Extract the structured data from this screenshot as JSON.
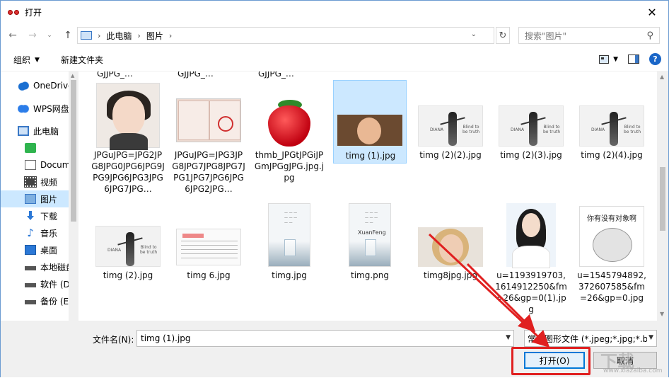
{
  "window": {
    "title": "打开",
    "close_glyph": "✕"
  },
  "nav": {
    "back": "←",
    "forward": "→",
    "up": "↑",
    "dropdown": "⌄",
    "breadcrumbs": [
      "此电脑",
      "图片"
    ],
    "sep": "›",
    "refresh": "↻",
    "search_placeholder": "搜索\"图片\""
  },
  "toolbar": {
    "organize": "组织",
    "new_folder": "新建文件夹",
    "help": "?"
  },
  "sidebar": {
    "items": [
      {
        "label": "OneDrive",
        "icon": "cloud-icon"
      },
      {
        "label": "WPS网盘",
        "icon": "wps-cloud-icon"
      },
      {
        "label": "此电脑",
        "icon": "computer-icon"
      },
      {
        "label": "",
        "icon": "green-app-icon"
      },
      {
        "label": "Documents",
        "icon": "document-icon"
      },
      {
        "label": "视频",
        "icon": "video-icon"
      },
      {
        "label": "图片",
        "icon": "pictures-icon"
      },
      {
        "label": "下载",
        "icon": "download-icon"
      },
      {
        "label": "音乐",
        "icon": "music-icon"
      },
      {
        "label": "桌面",
        "icon": "desktop-icon"
      },
      {
        "label": "本地磁盘",
        "icon": "drive-icon"
      },
      {
        "label": "软件 (D",
        "icon": "drive-icon"
      },
      {
        "label": "备份 (E",
        "icon": "drive-icon"
      }
    ]
  },
  "files": {
    "cutoff_row": [
      "GJJPG_…",
      "GJJPG_…",
      "GJJPG_…"
    ],
    "row1": [
      {
        "name": "JPGuJPG=JPG2JPG8JPG0JPG6JPG9JPG9JPG6JPG3JPG6JPG7JPG…",
        "thumb": "girl"
      },
      {
        "name": "JPGuJPG=JPG3JPG8JPG7JPG8JPG7JPG1JPG7JPG6JPG6JPG2JPG…",
        "thumb": "passport"
      },
      {
        "name": "thmb_JPGtJPGiJPGmJPGgJPG.jpg.jpg",
        "thumb": "strawberry"
      },
      {
        "name": "timg (1).jpg",
        "thumb": "boy",
        "selected": true
      },
      {
        "name": "timg (2)(2).jpg",
        "thumb": "dance"
      },
      {
        "name": "timg (2)(3).jpg",
        "thumb": "dance"
      },
      {
        "name": "timg (2)(4).jpg",
        "thumb": "dance"
      }
    ],
    "row2": [
      {
        "name": "timg (2).jpg",
        "thumb": "dance"
      },
      {
        "name": "timg 6.jpg",
        "thumb": "receipt"
      },
      {
        "name": "timg.jpg",
        "thumb": "poster"
      },
      {
        "name": "timg.png",
        "thumb": "poster-xf"
      },
      {
        "name": "timg8jpg.jpg",
        "thumb": "woman"
      },
      {
        "name": "u=1193919703,1614912250&fm=26&gp=0(1).jpg",
        "thumb": "portrait"
      },
      {
        "name": "u=1545794892,372607585&fm=26&gp=0.jpg",
        "thumb": "hamster"
      }
    ],
    "poster_text": "XuanFeng",
    "hamster_text": "你有没有对象啊"
  },
  "bottom": {
    "filename_label": "文件名(N):",
    "filename_value": "timg (1).jpg",
    "filter_value": "常见图形文件 (*.jpeg;*.jpg;*.b",
    "open_button": "打开(O)",
    "cancel_button": "取消"
  },
  "annotation": {
    "color": "#e02020"
  },
  "watermark": {
    "text": "下载",
    "url": "www.xiazaiba.com"
  }
}
